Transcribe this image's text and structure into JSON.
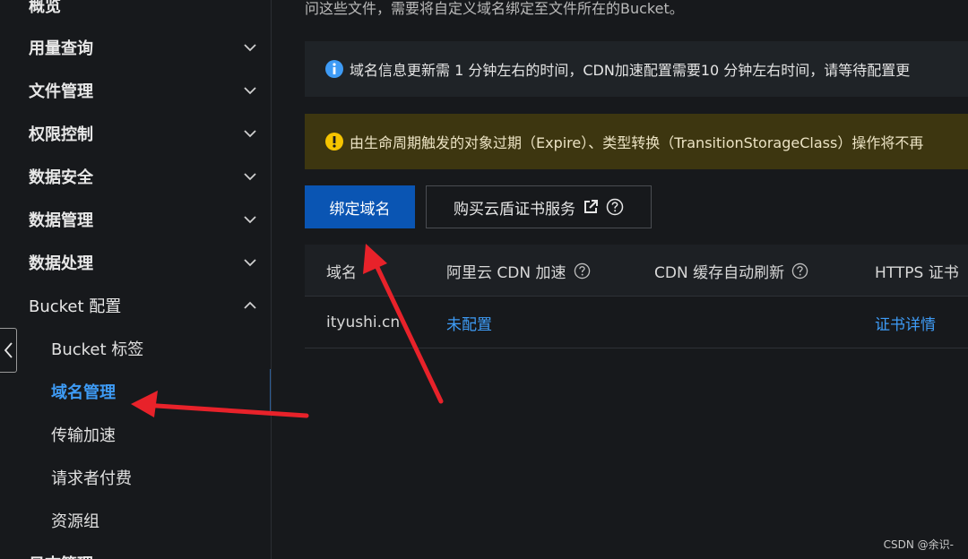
{
  "sidebar": {
    "overview": "概览",
    "groups": [
      {
        "label": "用量查询"
      },
      {
        "label": "文件管理"
      },
      {
        "label": "权限控制"
      },
      {
        "label": "数据安全"
      },
      {
        "label": "数据管理"
      },
      {
        "label": "数据处理"
      }
    ],
    "bucket_config": "Bucket 配置",
    "sub_items": [
      {
        "label": "Bucket 标签"
      },
      {
        "label": "域名管理"
      },
      {
        "label": "传输加速"
      },
      {
        "label": "请求者付费"
      },
      {
        "label": "资源组"
      }
    ],
    "bottom_item": "日志管理"
  },
  "main": {
    "intro_text": "问这些文件，需要将自定义域名绑定至文件所在的Bucket。",
    "info_notice": "域名信息更新需 1 分钟左右的时间，CDN加速配置需要10 分钟左右时间，请等待配置更",
    "warning_notice": "由生命周期触发的对象过期（Expire）、类型转换（TransitionStorageClass）操作将不再",
    "bind_button": "绑定域名",
    "buy_cert_button": "购买云盾证书服务",
    "table": {
      "headers": [
        "域名",
        "阿里云 CDN 加速",
        "CDN 缓存自动刷新",
        "HTTPS 证书"
      ],
      "rows": [
        {
          "domain": "ityushi.cn",
          "cdn": "未配置",
          "cert": "证书详情"
        }
      ]
    }
  },
  "watermark": "CSDN @余识-",
  "colors": {
    "accent": "#3e9bf5",
    "primary_button": "#0a55b3",
    "warning_bg": "#3d3610",
    "annotation": "#e8222a"
  }
}
